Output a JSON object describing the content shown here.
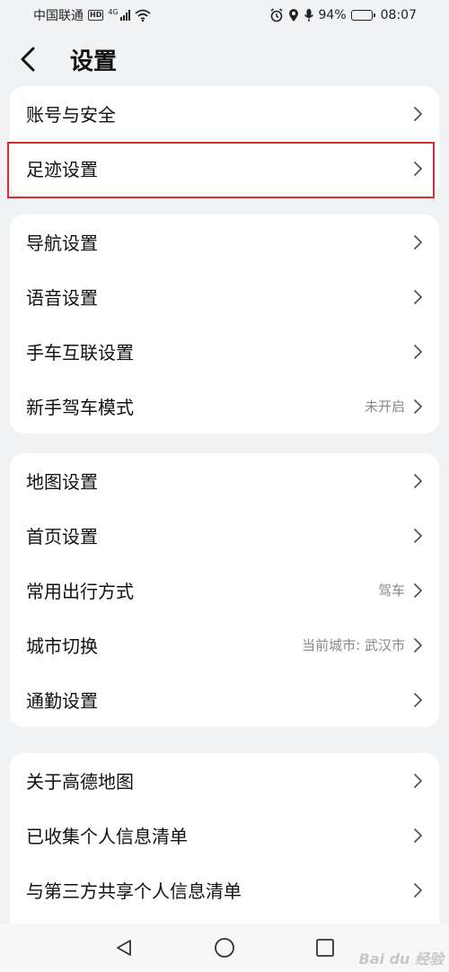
{
  "status_bar": {
    "carrier": "中国联通",
    "hd": "HD",
    "network": "4G",
    "battery": "94%",
    "battery_level": 0.94,
    "time": "08:07"
  },
  "header": {
    "title": "设置"
  },
  "groups": [
    {
      "items": [
        {
          "label": "账号与安全",
          "value": ""
        },
        {
          "label": "足迹设置",
          "value": ""
        }
      ]
    },
    {
      "items": [
        {
          "label": "导航设置",
          "value": ""
        },
        {
          "label": "语音设置",
          "value": ""
        },
        {
          "label": "手车互联设置",
          "value": ""
        },
        {
          "label": "新手驾车模式",
          "value": "未开启"
        }
      ]
    },
    {
      "items": [
        {
          "label": "地图设置",
          "value": ""
        },
        {
          "label": "首页设置",
          "value": ""
        },
        {
          "label": "常用出行方式",
          "value": "驾车"
        },
        {
          "label": "城市切换",
          "value": "当前城市: 武汉市"
        },
        {
          "label": "通勤设置",
          "value": ""
        }
      ]
    },
    {
      "items": [
        {
          "label": "关于高德地图",
          "value": ""
        },
        {
          "label": "已收集个人信息清单",
          "value": ""
        },
        {
          "label": "与第三方共享个人信息清单",
          "value": ""
        }
      ]
    }
  ],
  "watermark": "Bai du 经验",
  "colors": {
    "highlight": "#d32f2f",
    "background": "#f1f2f4"
  }
}
